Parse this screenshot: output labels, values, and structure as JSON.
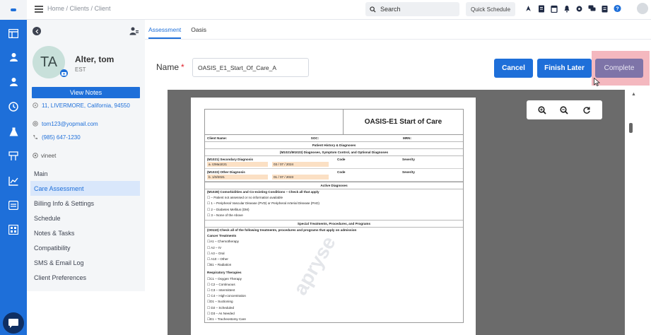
{
  "topbar": {
    "breadcrumb": "Home / Clients / Client",
    "search_placeholder": "Search",
    "quick_schedule": "Quick Schedule",
    "icons": [
      "rocket-icon",
      "document-icon",
      "calendar-icon",
      "bell-icon",
      "gear-icon",
      "chat-icon",
      "clipboard-icon",
      "help-icon"
    ]
  },
  "rail": {
    "icons": [
      "dashboard-icon",
      "client-icon",
      "person-icon",
      "clock-icon",
      "flask-icon",
      "org-chart-icon",
      "chart-icon",
      "billing-icon",
      "calculator-icon"
    ]
  },
  "client": {
    "initials": "TA",
    "name": "Alter, tom",
    "timezone": "EST",
    "view_notes": "View Notes",
    "address": "11, LIVERMORE, California, 94550",
    "email": "tom123@yopmail.com",
    "phone": "(985) 647-1230",
    "assignee": "vineet"
  },
  "menu": {
    "items": [
      {
        "label": "Main",
        "active": false
      },
      {
        "label": "Care Assessment",
        "active": true
      },
      {
        "label": "Billing Info & Settings",
        "active": false
      },
      {
        "label": "Schedule",
        "active": false
      },
      {
        "label": "Notes & Tasks",
        "active": false
      },
      {
        "label": "Compatibility",
        "active": false
      },
      {
        "label": "SMS & Email Log",
        "active": false
      },
      {
        "label": "Client Preferences",
        "active": false
      }
    ]
  },
  "tabs": {
    "assessment": "Assessment",
    "oasis": "Oasis"
  },
  "form": {
    "name_label": "Name",
    "required_mark": "*",
    "name_value": "OASIS_E1_Start_Of_Care_A",
    "cancel": "Cancel",
    "finish_later": "Finish Later",
    "complete": "Complete"
  },
  "document": {
    "title": "OASIS-E1 Start of Care",
    "client_name": "Client Name:",
    "soc": "SOC:",
    "mrn": "MRN:",
    "sec_history": "Patient History & Diagnoses",
    "sec_diag": "(M1021/M1023) Diagnoses, Symptom Control, and Optional Diagnoses",
    "m1021": "(M1021) Secondary Diagnosis",
    "m1023": "(M1023) Other Diagnosis",
    "code": "Code",
    "severity": "Severity",
    "diag1_value": "a. I2Ma1E21",
    "diag1_date": "03 / 07 / 2024",
    "diag2_value": "b. 1/0/2021",
    "diag2_date": "01 / 07 / 2023",
    "sec_active": "Active Diagnoses",
    "m1028": "(M1028) Comorbidities and Co-existing Conditions – Check all that apply",
    "m1028_items": [
      "☐ – Patient not assessed or no information available",
      "☐ 1 – Peripheral Vascular Disease (PVD) or Peripheral Arterial Disease (PAD)",
      "☐ 2 – Diabetes Mellitus (DM)",
      "☐ 3 – None of the Above"
    ],
    "sec_special": "Special Treatments, Procedures, and Programs",
    "o0110": "(O0110) Check all of the following treatments, procedures and programs that apply on admission",
    "cancer_head": "Cancer Treatments",
    "cancer_items": [
      "☐A1 – Chemotherapy",
      "☐      A2 – IV",
      "☐      A3 – Oral",
      "☐      A10 – Other",
      "☐B1 – Radiation"
    ],
    "resp_head": "Respiratory Therapies",
    "resp_items": [
      "☐C1 – Oxygen Therapy",
      "☐      C2 – Continuous",
      "☐      C3 – Intermittent",
      "☐      C4 – High-concentration",
      "☐D1 – Suctioning",
      "☐      D2 – Scheduled",
      "☐      D3 – As Needed",
      "☐E1 – Tracheostomy Care"
    ],
    "watermark": "apryse"
  }
}
